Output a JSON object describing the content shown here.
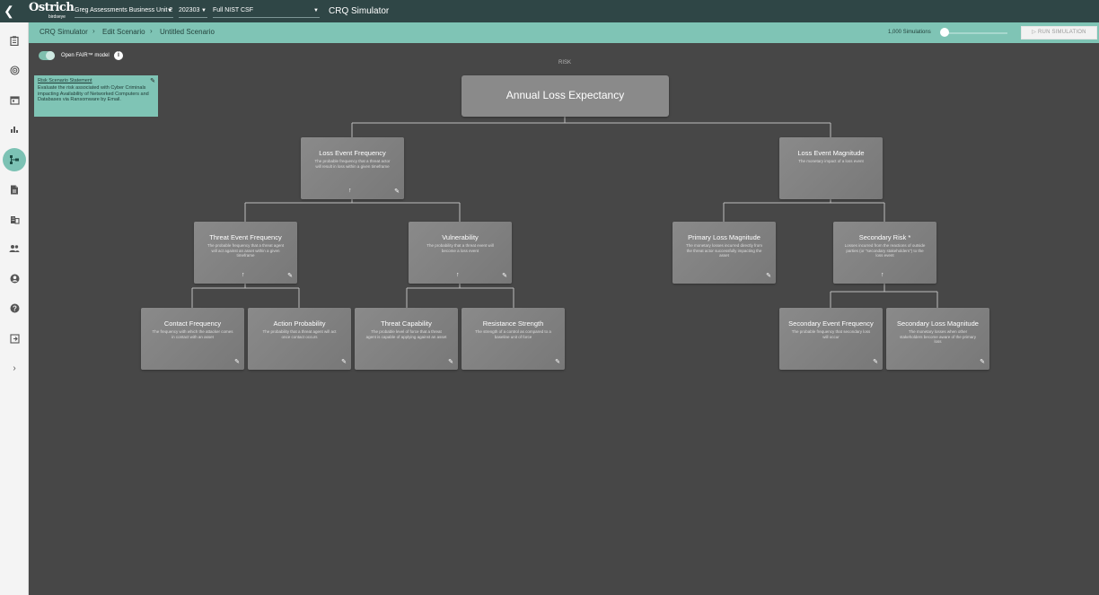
{
  "topbar": {
    "logo": "Ostrich",
    "logo_sub": "birdseye",
    "business_unit": "Greg Assessments Business Unit 2",
    "period": "202303",
    "framework": "Full NIST CSF",
    "app_title": "CRQ Simulator"
  },
  "breadcrumb": {
    "items": [
      "CRQ Simulator",
      "Edit Scenario",
      "Untitled Scenario"
    ],
    "simulations_label": "1,000 Simulations",
    "run_button": "RUN SIMULATION"
  },
  "toggle": {
    "label": "Open FAIR™ model",
    "on": true
  },
  "risk_label": "RISK",
  "statement": {
    "title": "Risk Scenario Statement",
    "body": "Evaluate the risk associated with Cyber Criminals impacting Availability of Networked Computers and Databases via Ransomware by Email."
  },
  "ale": {
    "title": "Annual Loss Expectancy"
  },
  "nodes": {
    "lef": {
      "title": "Loss Event Frequency",
      "desc": "The probable frequency that a threat actor will result in loss within a given timeframe"
    },
    "lem": {
      "title": "Loss Event Magnitude",
      "desc": "The monetary impact of a loss event"
    },
    "tef": {
      "title": "Threat Event Frequency",
      "desc": "The probable frequency that a threat agent will act against an asset within a given timeframe"
    },
    "vul": {
      "title": "Vulnerability",
      "desc": "The probability that a threat event will become a loss event"
    },
    "plm": {
      "title": "Primary Loss Magnitude",
      "desc": "The monetary losses incurred directly from the threat actor successfully impacting the asset"
    },
    "sr": {
      "title": "Secondary Risk *",
      "desc": "Losses incurred from the reactions of outside parties (or \"secondary stakeholders\") to the loss event"
    },
    "cf": {
      "title": "Contact Frequency",
      "desc": "The frequency with which the attacker comes in contact with an asset"
    },
    "ap": {
      "title": "Action Probability",
      "desc": "The probability that a threat agent will act once contact occurs"
    },
    "tc": {
      "title": "Threat Capability",
      "desc": "The probable level of force that a threat agent is capable of applying against an asset"
    },
    "rs": {
      "title": "Resistance Strength",
      "desc": "The strength of a control as compared to a baseline unit of force"
    },
    "sef": {
      "title": "Secondary Event Frequency",
      "desc": "The probable frequency that secondary loss will occur"
    },
    "slm": {
      "title": "Secondary Loss Magnitude",
      "desc": "The monetary losses when other stakeholders become aware of the primary loss"
    }
  },
  "icons": {
    "back": "chevron-left-icon",
    "edit": "pencil-icon",
    "expand": "arrow-up-icon",
    "info": "info-icon"
  },
  "colors": {
    "topbar": "#2f4646",
    "accent": "#7fc4b5",
    "canvas": "#474747",
    "node": "#858585"
  }
}
